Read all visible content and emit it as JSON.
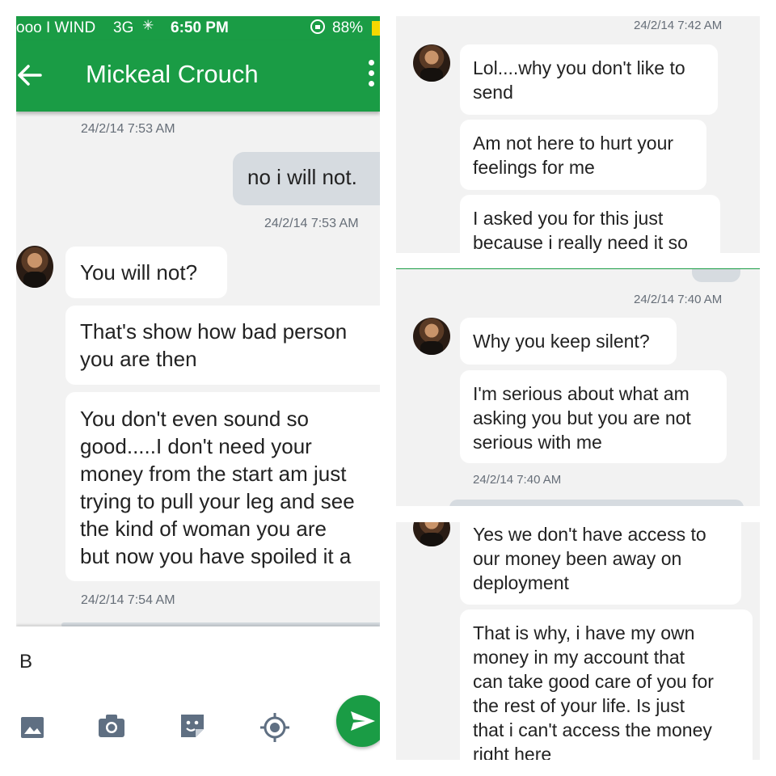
{
  "left": {
    "status": {
      "carrier": "ooo I WIND",
      "network": "3G",
      "time": "6:50 PM",
      "battery": "88%"
    },
    "header": {
      "title": "Mickeal Crouch"
    },
    "messages": {
      "ts1": "24/2/14 7:53 AM",
      "sent1": "no i will not.",
      "ts2": "24/2/14 7:53 AM",
      "m1": "You will not?",
      "m2": "That's show how bad person\nyou are then",
      "m3": "You don't even sound so\ngood.....I don't need your\nmoney from the start am just\ntrying to pull your leg and see\nthe kind of woman you are\nbut now you have spoiled it a",
      "ts3": "24/2/14 7:54 AM"
    },
    "composer": {
      "value": "B"
    }
  },
  "right1": {
    "ts": "24/2/14 7:42 AM",
    "m1": "Lol....why you don't like to\nsend",
    "m2": "Am not here to hurt your\nfeelings for me",
    "m3": "I asked you for this just\nbecause i really need it so"
  },
  "right2": {
    "ts": "24/2/14 7:40 AM",
    "m1": "Why you keep silent?",
    "m2": "I'm serious about what am\nasking you but you are not\nserious with me",
    "ts2": "24/2/14 7:40 AM"
  },
  "right3": {
    "m1": "Yes we don't have access to\nour money been away on\ndeployment",
    "m2": "That is why, i have my own\nmoney in my account that\ncan take good care of you for\nthe rest of your life. Is just\nthat i can't access the money\nright here"
  },
  "colors": {
    "brand": "#1a9c45",
    "sent_bubble": "#d6dbe0",
    "received_bubble": "#ffffff",
    "background": "#f2f2f2"
  },
  "icons": [
    "back-arrow-icon",
    "overflow-menu-icon",
    "image-icon",
    "camera-icon",
    "sticker-icon",
    "location-icon",
    "send-icon",
    "battery-icon",
    "rotation-lock-icon",
    "signal-dots-icon"
  ]
}
